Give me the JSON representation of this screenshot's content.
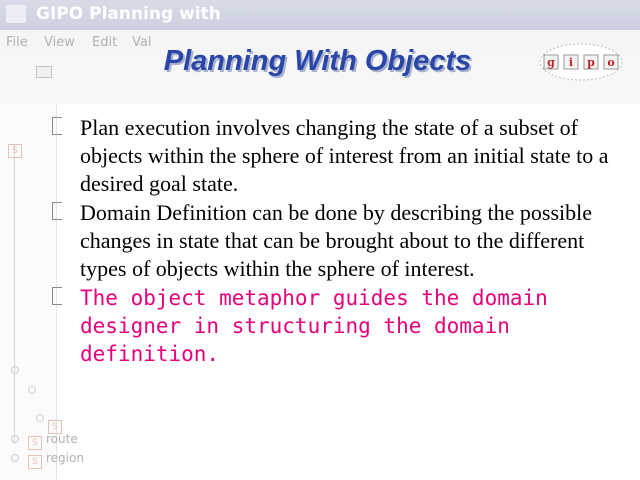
{
  "background_app": {
    "title": "GIPO Planning with",
    "menu": [
      "File",
      "View",
      "Edit",
      "Val"
    ],
    "tree_items": [
      "route",
      "region"
    ]
  },
  "slide": {
    "title": "Planning With Objects",
    "logo_letters": [
      "g",
      "i",
      "p",
      "o"
    ],
    "bullets": [
      "Plan execution involves changing the state of a subset of objects within the sphere of interest from an initial state to a desired goal state.",
      "Domain Definition can be done by describing the possible changes in state that can be brought about to the different types of objects within the sphere of interest.",
      "The object metaphor guides the domain designer in structuring the domain definition."
    ]
  },
  "colors": {
    "title": "#2946a8",
    "highlight_bullet": "#e8007a",
    "logo_red": "#c0242b"
  }
}
